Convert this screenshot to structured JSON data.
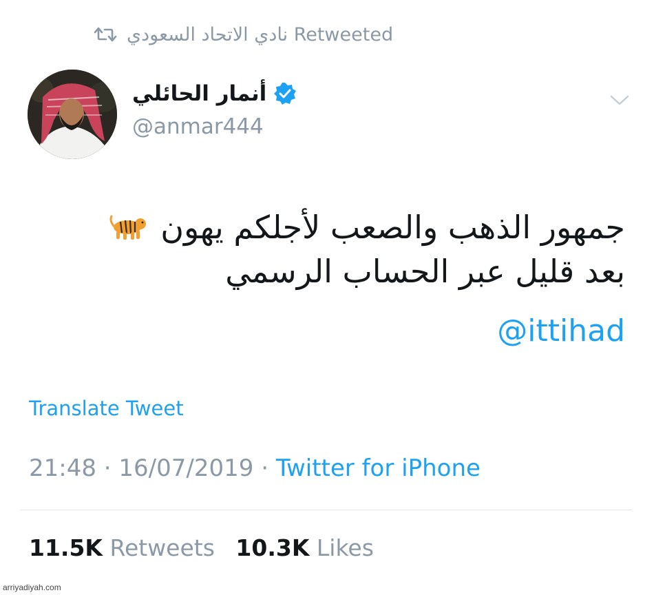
{
  "retweet": {
    "label": "نادي الاتحاد السعودي Retweeted",
    "icon": "retweet-icon"
  },
  "author": {
    "name": "أنمار الحائلي",
    "handle": "@anmar444",
    "verified": true,
    "avatar": "avatar-photo"
  },
  "tweet": {
    "line1": "جمهور الذهب والصعب لأجلكم يهون",
    "line1_emoji": "tiger-icon",
    "line2": "بعد قليل عبر الحساب الرسمي",
    "mention": "@ittihad"
  },
  "translate_label": "Translate Tweet",
  "meta": {
    "time": "21:48",
    "separator": "·",
    "date": "16/07/2019",
    "source": "Twitter for iPhone"
  },
  "stats": {
    "retweets_count": "11.5K",
    "retweets_label": "Retweets",
    "likes_count": "10.3K",
    "likes_label": "Likes"
  },
  "colors": {
    "link": "#1da1f2",
    "muted": "#8b98a5",
    "text": "#14171a"
  },
  "watermark": "arriyadiyah.com"
}
